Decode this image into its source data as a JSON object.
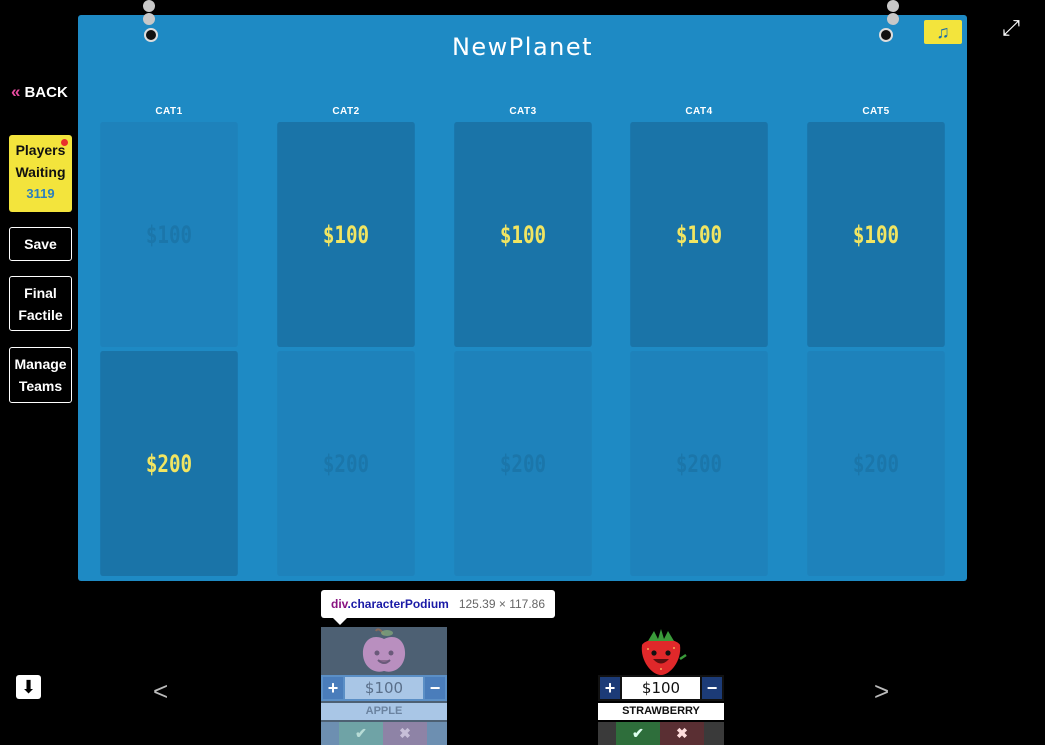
{
  "nav": {
    "back_label": "BACK",
    "back_chevron": "«"
  },
  "sidebar": {
    "players_label_1": "Players",
    "players_label_2": "Waiting",
    "players_count": "3119",
    "buttons": [
      {
        "line1": "Save",
        "line2": ""
      },
      {
        "line1": "Final",
        "line2": "Factile"
      },
      {
        "line1": "Manage",
        "line2": "Teams"
      }
    ]
  },
  "board": {
    "title": "NewPlanet",
    "music_icon": "music-note-icon",
    "categories": [
      "CAT1",
      "CAT2",
      "CAT3",
      "CAT4",
      "CAT5"
    ],
    "rows": [
      {
        "value": "$100",
        "states": [
          "used",
          "active",
          "active",
          "active",
          "active"
        ]
      },
      {
        "value": "$200",
        "states": [
          "active",
          "used",
          "used",
          "used",
          "used"
        ]
      }
    ]
  },
  "tooltip": {
    "tag": "div",
    "class": ".characterPodium",
    "dims": "125.39 × 117.86"
  },
  "podiums": [
    {
      "name": "APPLE",
      "score": "$100",
      "style": "light",
      "avatar": "apple-avatar"
    },
    {
      "name": "STRAWBERRY",
      "score": "$100",
      "style": "dark",
      "avatar": "strawberry-avatar"
    }
  ],
  "controls": {
    "prev": "<",
    "next": ">",
    "plus": "+",
    "minus": "−",
    "check": "✔",
    "cross": "✖"
  },
  "colors": {
    "board": "#1e8ac4",
    "tile_active": "#1a74a8",
    "tile_text": "#f1e562",
    "accent_yellow": "#f3e43c",
    "back_chevron": "#e84ba0"
  }
}
